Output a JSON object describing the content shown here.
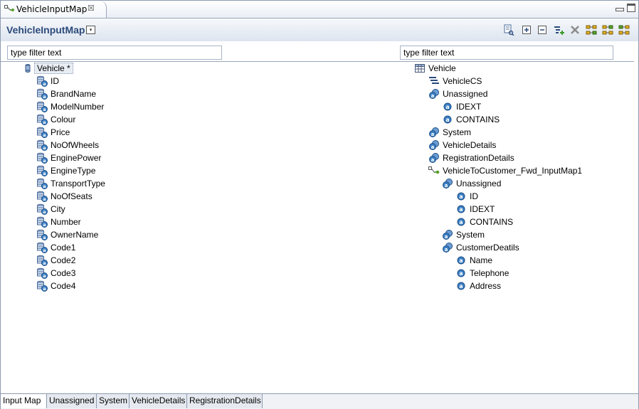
{
  "editor_tab": {
    "label": "VehicleInputMap",
    "close": "☒"
  },
  "header": {
    "title": "VehicleInputMap",
    "menu_glyph": "▾"
  },
  "toolbar": {
    "icons": [
      "search-record-icon",
      "expand-all-icon",
      "collapse-all-icon",
      "add-mapping-icon",
      "delete-icon",
      "layout-icon",
      "layout-icon",
      "layout-icon"
    ]
  },
  "filters": {
    "left_value": "type filter text",
    "right_value": "type filter text"
  },
  "left_tree": {
    "root": {
      "label": "Vehicle *",
      "icon": "entity-icon"
    },
    "fields": [
      "ID",
      "BrandName",
      "ModelNumber",
      "Colour",
      "Price",
      "NoOfWheels",
      "EnginePower",
      "EngineType",
      "TransportType",
      "NoOfSeats",
      "City",
      "Number",
      "OwnerName",
      "Code1",
      "Code2",
      "Code3",
      "Code4"
    ]
  },
  "right_tree": {
    "items": [
      {
        "label": "Vehicle",
        "icon": "table-icon"
      },
      {
        "label": "VehicleCS",
        "icon": "column-set-icon"
      },
      {
        "label": "Unassigned",
        "icon": "group-icon"
      },
      {
        "label": "IDEXT",
        "icon": "attribute-icon"
      },
      {
        "label": "CONTAINS",
        "icon": "attribute-icon"
      },
      {
        "label": "System",
        "icon": "group-icon"
      },
      {
        "label": "VehicleDetails",
        "icon": "group-icon"
      },
      {
        "label": "RegistrationDetails",
        "icon": "group-icon"
      },
      {
        "label": "VehicleToCustomer_Fwd_InputMap1",
        "icon": "relationship-icon"
      },
      {
        "label": "Unassigned",
        "icon": "group-icon"
      },
      {
        "label": "ID",
        "icon": "attribute-icon"
      },
      {
        "label": "IDEXT",
        "icon": "attribute-icon"
      },
      {
        "label": "CONTAINS",
        "icon": "attribute-icon"
      },
      {
        "label": "System",
        "icon": "group-icon"
      },
      {
        "label": "CustomerDeatils",
        "icon": "group-icon"
      },
      {
        "label": "Name",
        "icon": "attribute-icon"
      },
      {
        "label": "Telephone",
        "icon": "attribute-icon"
      },
      {
        "label": "Address",
        "icon": "attribute-icon"
      }
    ]
  },
  "bottom_tabs": [
    "Input Map",
    "Unassigned",
    "System",
    "VehicleDetails",
    "RegistrationDetails"
  ],
  "colors": {
    "title": "#2c4a7a",
    "accent_blue": "#3a7fc4",
    "border": "#8c9ab0"
  }
}
